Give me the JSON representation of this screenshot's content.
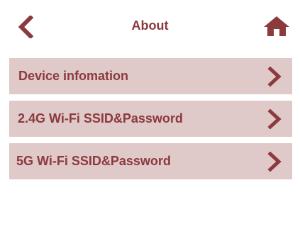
{
  "header": {
    "title": "About",
    "back_icon": "chevron-left-icon",
    "home_icon": "home-icon"
  },
  "menu": {
    "items": [
      {
        "label": "Device infomation",
        "icon": "chevron-right-icon"
      },
      {
        "label": "2.4G Wi-Fi SSID&Password",
        "icon": "chevron-right-icon"
      },
      {
        "label": "5G Wi-Fi SSID&Password",
        "icon": "chevron-right-icon"
      }
    ]
  },
  "colors": {
    "accent": "#8b3a3e",
    "item_background": "#e0c9c9",
    "background": "#ffffff"
  }
}
